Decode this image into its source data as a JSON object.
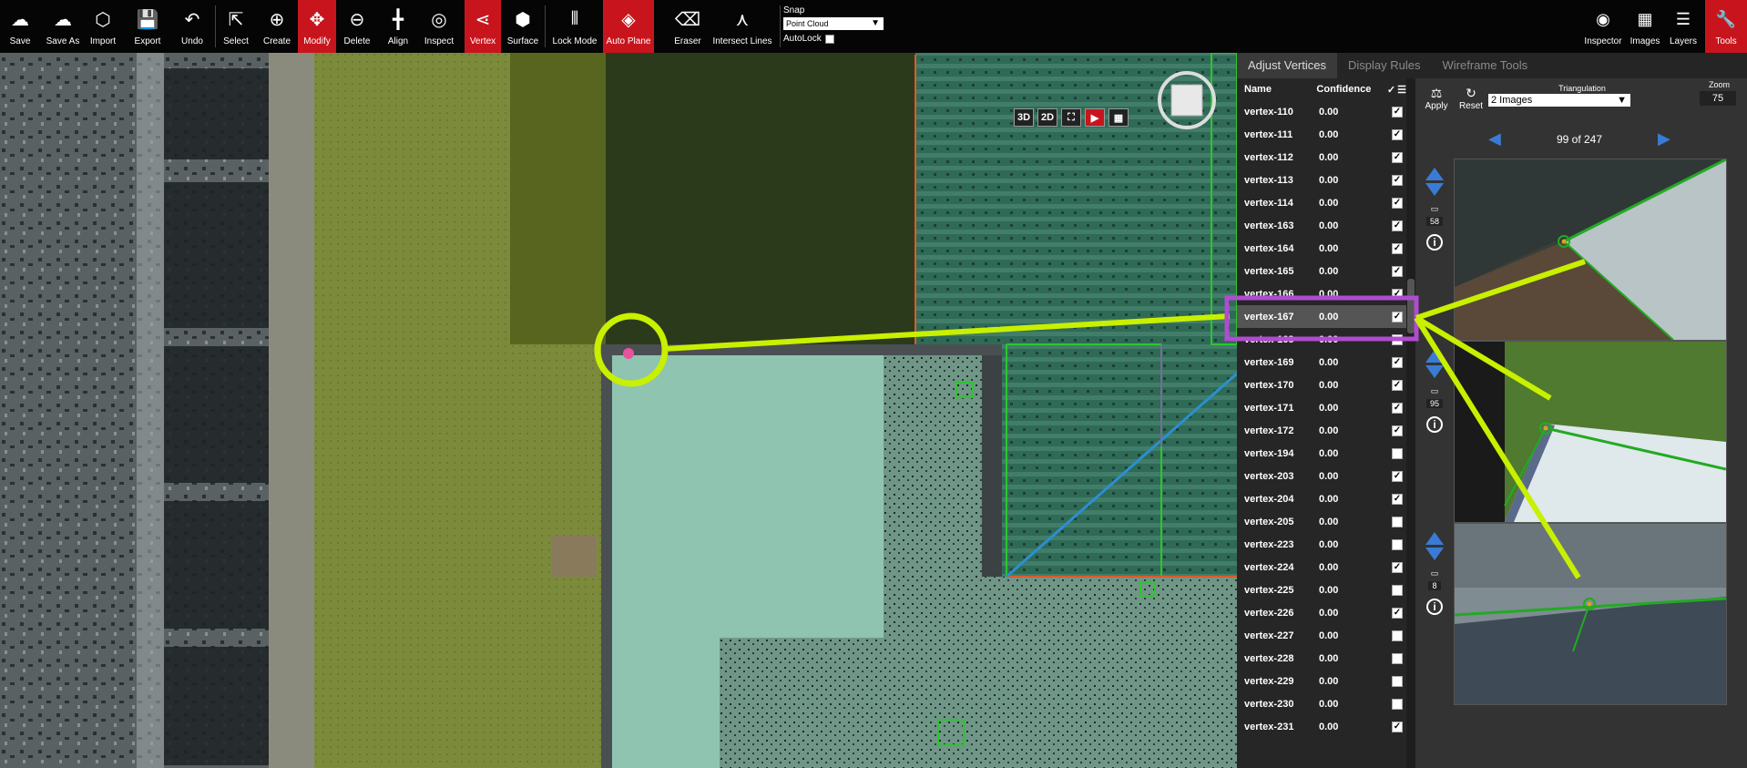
{
  "toolbar": {
    "buttons": [
      {
        "label": "Save",
        "icon": "cloud-upload-icon"
      },
      {
        "label": "Save As",
        "icon": "cloud-upload-icon"
      },
      {
        "label": "Import",
        "icon": "cube-outline-icon"
      },
      {
        "label": "Export",
        "icon": "floppy-icon"
      },
      {
        "label": "Undo",
        "icon": "undo-icon"
      },
      {
        "label": "Select",
        "icon": "select-cursor-icon"
      },
      {
        "label": "Create",
        "icon": "plus-circle-icon"
      },
      {
        "label": "Modify",
        "icon": "move-arrows-icon"
      },
      {
        "label": "Delete",
        "icon": "minus-node-icon"
      },
      {
        "label": "Align",
        "icon": "align-icon"
      },
      {
        "label": "Inspect",
        "icon": "crosshair-icon"
      },
      {
        "label": "Vertex",
        "icon": "vertex-share-icon"
      },
      {
        "label": "Surface",
        "icon": "cube-icon"
      },
      {
        "label": "Lock Mode",
        "icon": "lock-mode-icon"
      },
      {
        "label": "Auto Plane",
        "icon": "grid-diamond-icon"
      },
      {
        "label": "Eraser",
        "icon": "eraser-icon"
      },
      {
        "label": "Intersect Lines",
        "icon": "intersect-icon"
      }
    ],
    "snap": {
      "label": "Snap",
      "value": "Point Cloud",
      "autolock_label": "AutoLock"
    },
    "right": [
      {
        "label": "Inspector",
        "icon": "eye-icon"
      },
      {
        "label": "Images",
        "icon": "grid-icon"
      },
      {
        "label": "Layers",
        "icon": "layers-icon"
      },
      {
        "label": "Tools",
        "icon": "wrench-icon"
      }
    ],
    "active_color": "#c8151d"
  },
  "viewport": {
    "controls": [
      "3D",
      "2D"
    ]
  },
  "panel": {
    "tabs": [
      "Adjust Vertices",
      "Display Rules",
      "Wireframe Tools"
    ],
    "list_headers": {
      "name": "Name",
      "confidence": "Confidence",
      "check": "✓"
    },
    "vertices": [
      {
        "name": "vertex-110",
        "confidence": "0.00",
        "checked": true
      },
      {
        "name": "vertex-111",
        "confidence": "0.00",
        "checked": true
      },
      {
        "name": "vertex-112",
        "confidence": "0.00",
        "checked": true
      },
      {
        "name": "vertex-113",
        "confidence": "0.00",
        "checked": true
      },
      {
        "name": "vertex-114",
        "confidence": "0.00",
        "checked": true
      },
      {
        "name": "vertex-163",
        "confidence": "0.00",
        "checked": true
      },
      {
        "name": "vertex-164",
        "confidence": "0.00",
        "checked": true
      },
      {
        "name": "vertex-165",
        "confidence": "0.00",
        "checked": true
      },
      {
        "name": "vertex-166",
        "confidence": "0.00",
        "checked": true
      },
      {
        "name": "vertex-167",
        "confidence": "0.00",
        "checked": true
      },
      {
        "name": "vertex-168",
        "confidence": "0.00",
        "checked": false
      },
      {
        "name": "vertex-169",
        "confidence": "0.00",
        "checked": true
      },
      {
        "name": "vertex-170",
        "confidence": "0.00",
        "checked": true
      },
      {
        "name": "vertex-171",
        "confidence": "0.00",
        "checked": true
      },
      {
        "name": "vertex-172",
        "confidence": "0.00",
        "checked": true
      },
      {
        "name": "vertex-194",
        "confidence": "0.00",
        "checked": false
      },
      {
        "name": "vertex-203",
        "confidence": "0.00",
        "checked": true
      },
      {
        "name": "vertex-204",
        "confidence": "0.00",
        "checked": true
      },
      {
        "name": "vertex-205",
        "confidence": "0.00",
        "checked": false
      },
      {
        "name": "vertex-223",
        "confidence": "0.00",
        "checked": false
      },
      {
        "name": "vertex-224",
        "confidence": "0.00",
        "checked": true
      },
      {
        "name": "vertex-225",
        "confidence": "0.00",
        "checked": false
      },
      {
        "name": "vertex-226",
        "confidence": "0.00",
        "checked": true
      },
      {
        "name": "vertex-227",
        "confidence": "0.00",
        "checked": false
      },
      {
        "name": "vertex-228",
        "confidence": "0.00",
        "checked": false
      },
      {
        "name": "vertex-229",
        "confidence": "0.00",
        "checked": false
      },
      {
        "name": "vertex-230",
        "confidence": "0.00",
        "checked": false
      },
      {
        "name": "vertex-231",
        "confidence": "0.00",
        "checked": true
      }
    ],
    "selected_vertex": "vertex-167",
    "apply_label": "Apply",
    "reset_label": "Reset",
    "triangulation_label": "Triangulation",
    "triangulation_value": "2 Images",
    "zoom_label": "Zoom",
    "zoom_value": "75",
    "pager": "99 of 247",
    "image_counts": [
      "58",
      "95",
      "8"
    ],
    "highlight_color": "#c8f000",
    "selection_color": "#b04ccf"
  }
}
